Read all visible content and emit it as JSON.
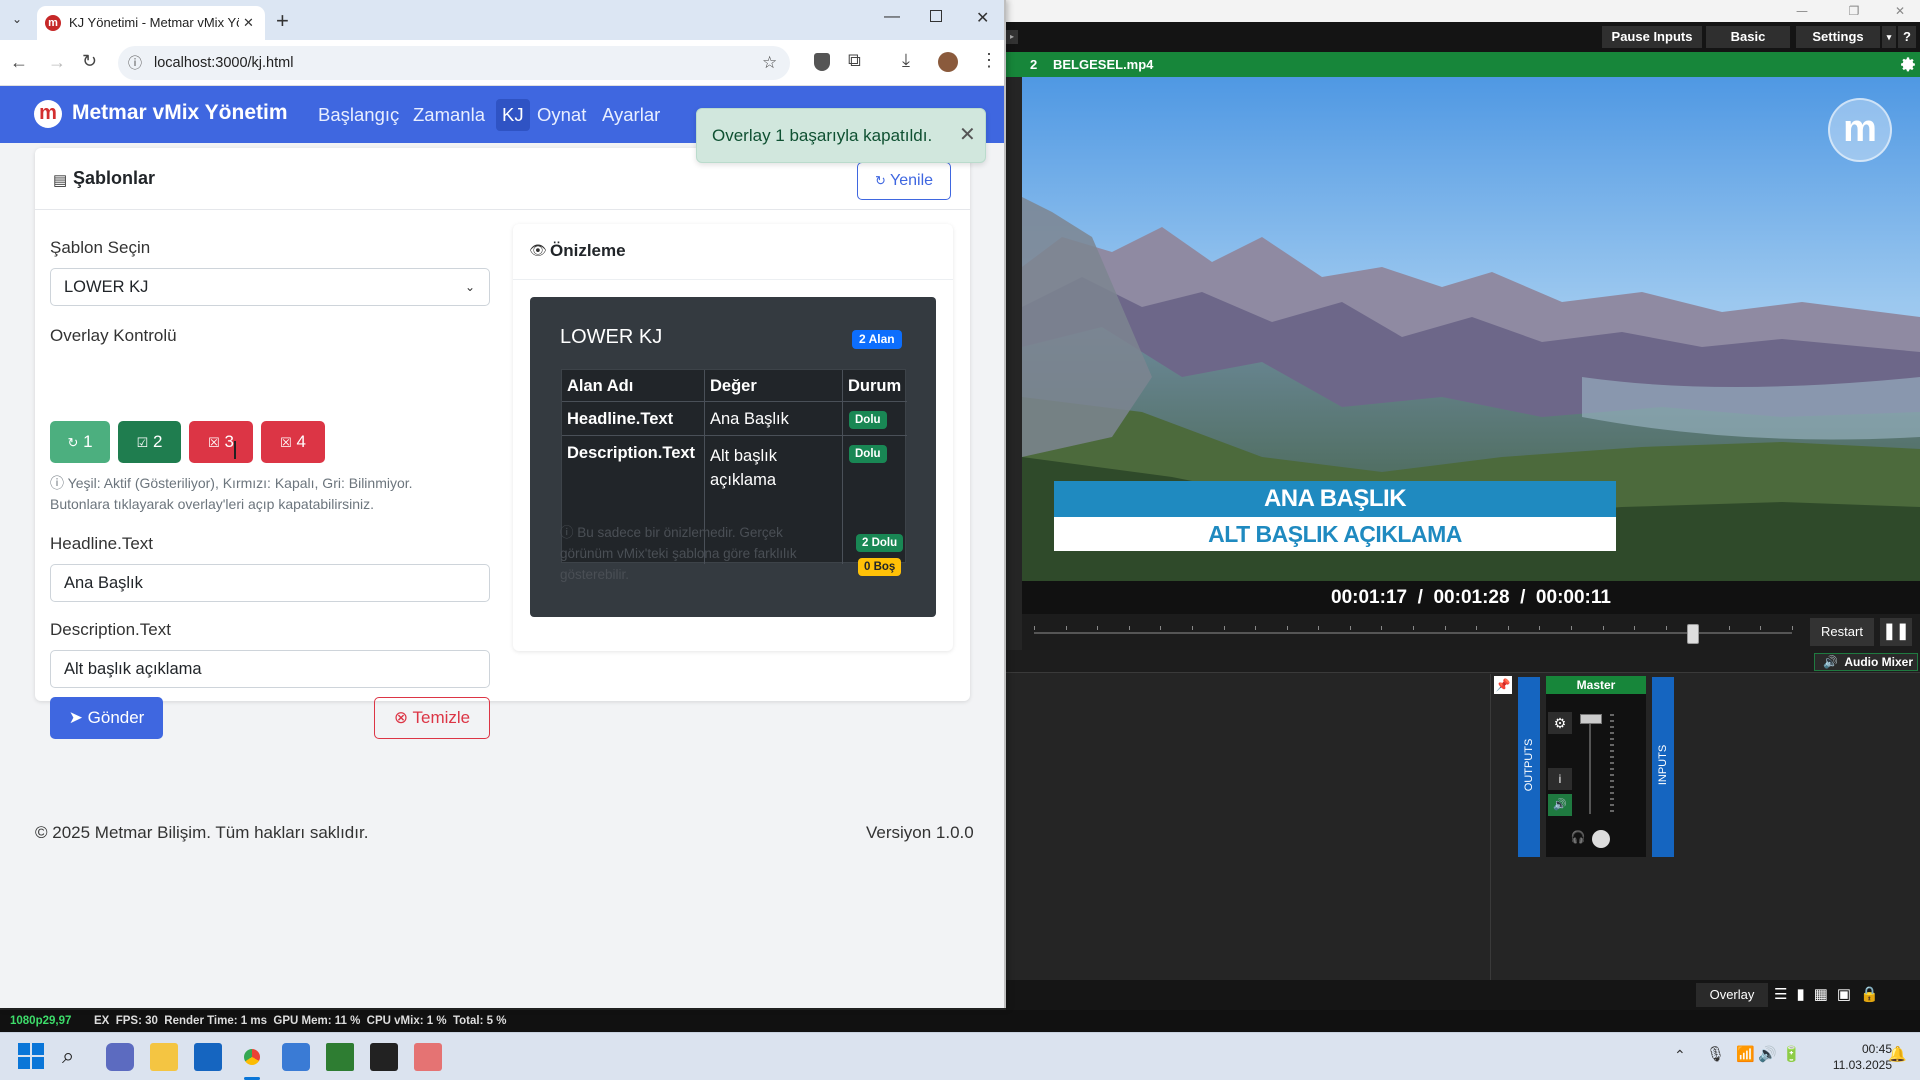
{
  "chrome": {
    "tab_title": "KJ Yönetimi - Metmar vMix Yön",
    "url": "localhost:3000/kj.html"
  },
  "app": {
    "brand": "Metmar vMix Yönetim",
    "nav": [
      "Başlangıç",
      "Zamanla",
      "KJ",
      "Oynat",
      "Ayarlar"
    ],
    "active_nav": "KJ",
    "toast": "Overlay 1 başarıyla kapatıldı.",
    "card_title": "Şablonlar",
    "refresh_label": "Yenile",
    "template_label": "Şablon Seçin",
    "template_value": "LOWER KJ",
    "overlay_label": "Overlay Kontrolü",
    "overlay_buttons": [
      {
        "label": "1",
        "state": "unknown",
        "color": "#4caf7f"
      },
      {
        "label": "2",
        "state": "active",
        "color": "#1f7d4f"
      },
      {
        "label": "3",
        "state": "closed",
        "color": "#dc3545"
      },
      {
        "label": "4",
        "state": "closed",
        "color": "#dc3545"
      }
    ],
    "help_text_1": "Yeşil: Aktif (Gösteriliyor), Kırmızı: Kapalı, Gri: Bilinmiyor.",
    "help_text_2": "Butonlara tıklayarak overlay'leri açıp kapatabilirsiniz.",
    "headline_label": "Headline.Text",
    "headline_value": "Ana Başlık",
    "description_label": "Description.Text",
    "description_value": "Alt başlık açıklama",
    "send_label": "Gönder",
    "clear_label": "Temizle",
    "preview": {
      "title": "Önizleme",
      "template_name": "LOWER KJ",
      "field_count_badge": "2 Alan",
      "headers": [
        "Alan Adı",
        "Değer",
        "Durum"
      ],
      "rows": [
        {
          "field": "Headline.Text",
          "value": "Ana Başlık",
          "status": "Dolu"
        },
        {
          "field": "Description.Text",
          "value": "Alt başlık açıklama",
          "status": "Dolu"
        }
      ],
      "note": "Bu sadece bir önizlemedir. Gerçek görünüm vMix'teki şablona göre farklılık gösterebilir.",
      "filled_badge": "2 Dolu",
      "empty_badge": "0 Boş"
    },
    "footer_copyright": "© 2025 Metmar Bilişim. Tüm hakları saklıdır.",
    "footer_version": "Versiyon 1.0.0"
  },
  "vmix": {
    "pause_inputs": "Pause Inputs",
    "basic": "Basic",
    "settings": "Settings",
    "help": "?",
    "input_number": "2",
    "input_name": "BELGESEL.mp4",
    "lower_third_title": "ANA BAŞLIK",
    "lower_third_subtitle": "ALT BAŞLIK AÇIKLAMA",
    "timecode": "00:01:17  /  00:01:28  /  00:00:11",
    "restart": "Restart",
    "audio_mixer": "Audio Mixer",
    "master": "Master",
    "outputs": "OUTPUTS",
    "inputs": "INPUTS",
    "overlay": "Overlay",
    "seek_position": 0.87
  },
  "vmix_status": {
    "format": "1080p29,97",
    "stats": "EX  FPS: 30  Render Time: 1 ms  GPU Mem: 11 %  CPU vMix: 1 %  Total: 5 %"
  },
  "taskbar": {
    "time": "00:45",
    "date": "11.03.2025"
  },
  "colors": {
    "primary": "#3f67e0",
    "success": "#1f7d4f",
    "danger": "#dc3545",
    "vmix_green": "#17863a"
  }
}
